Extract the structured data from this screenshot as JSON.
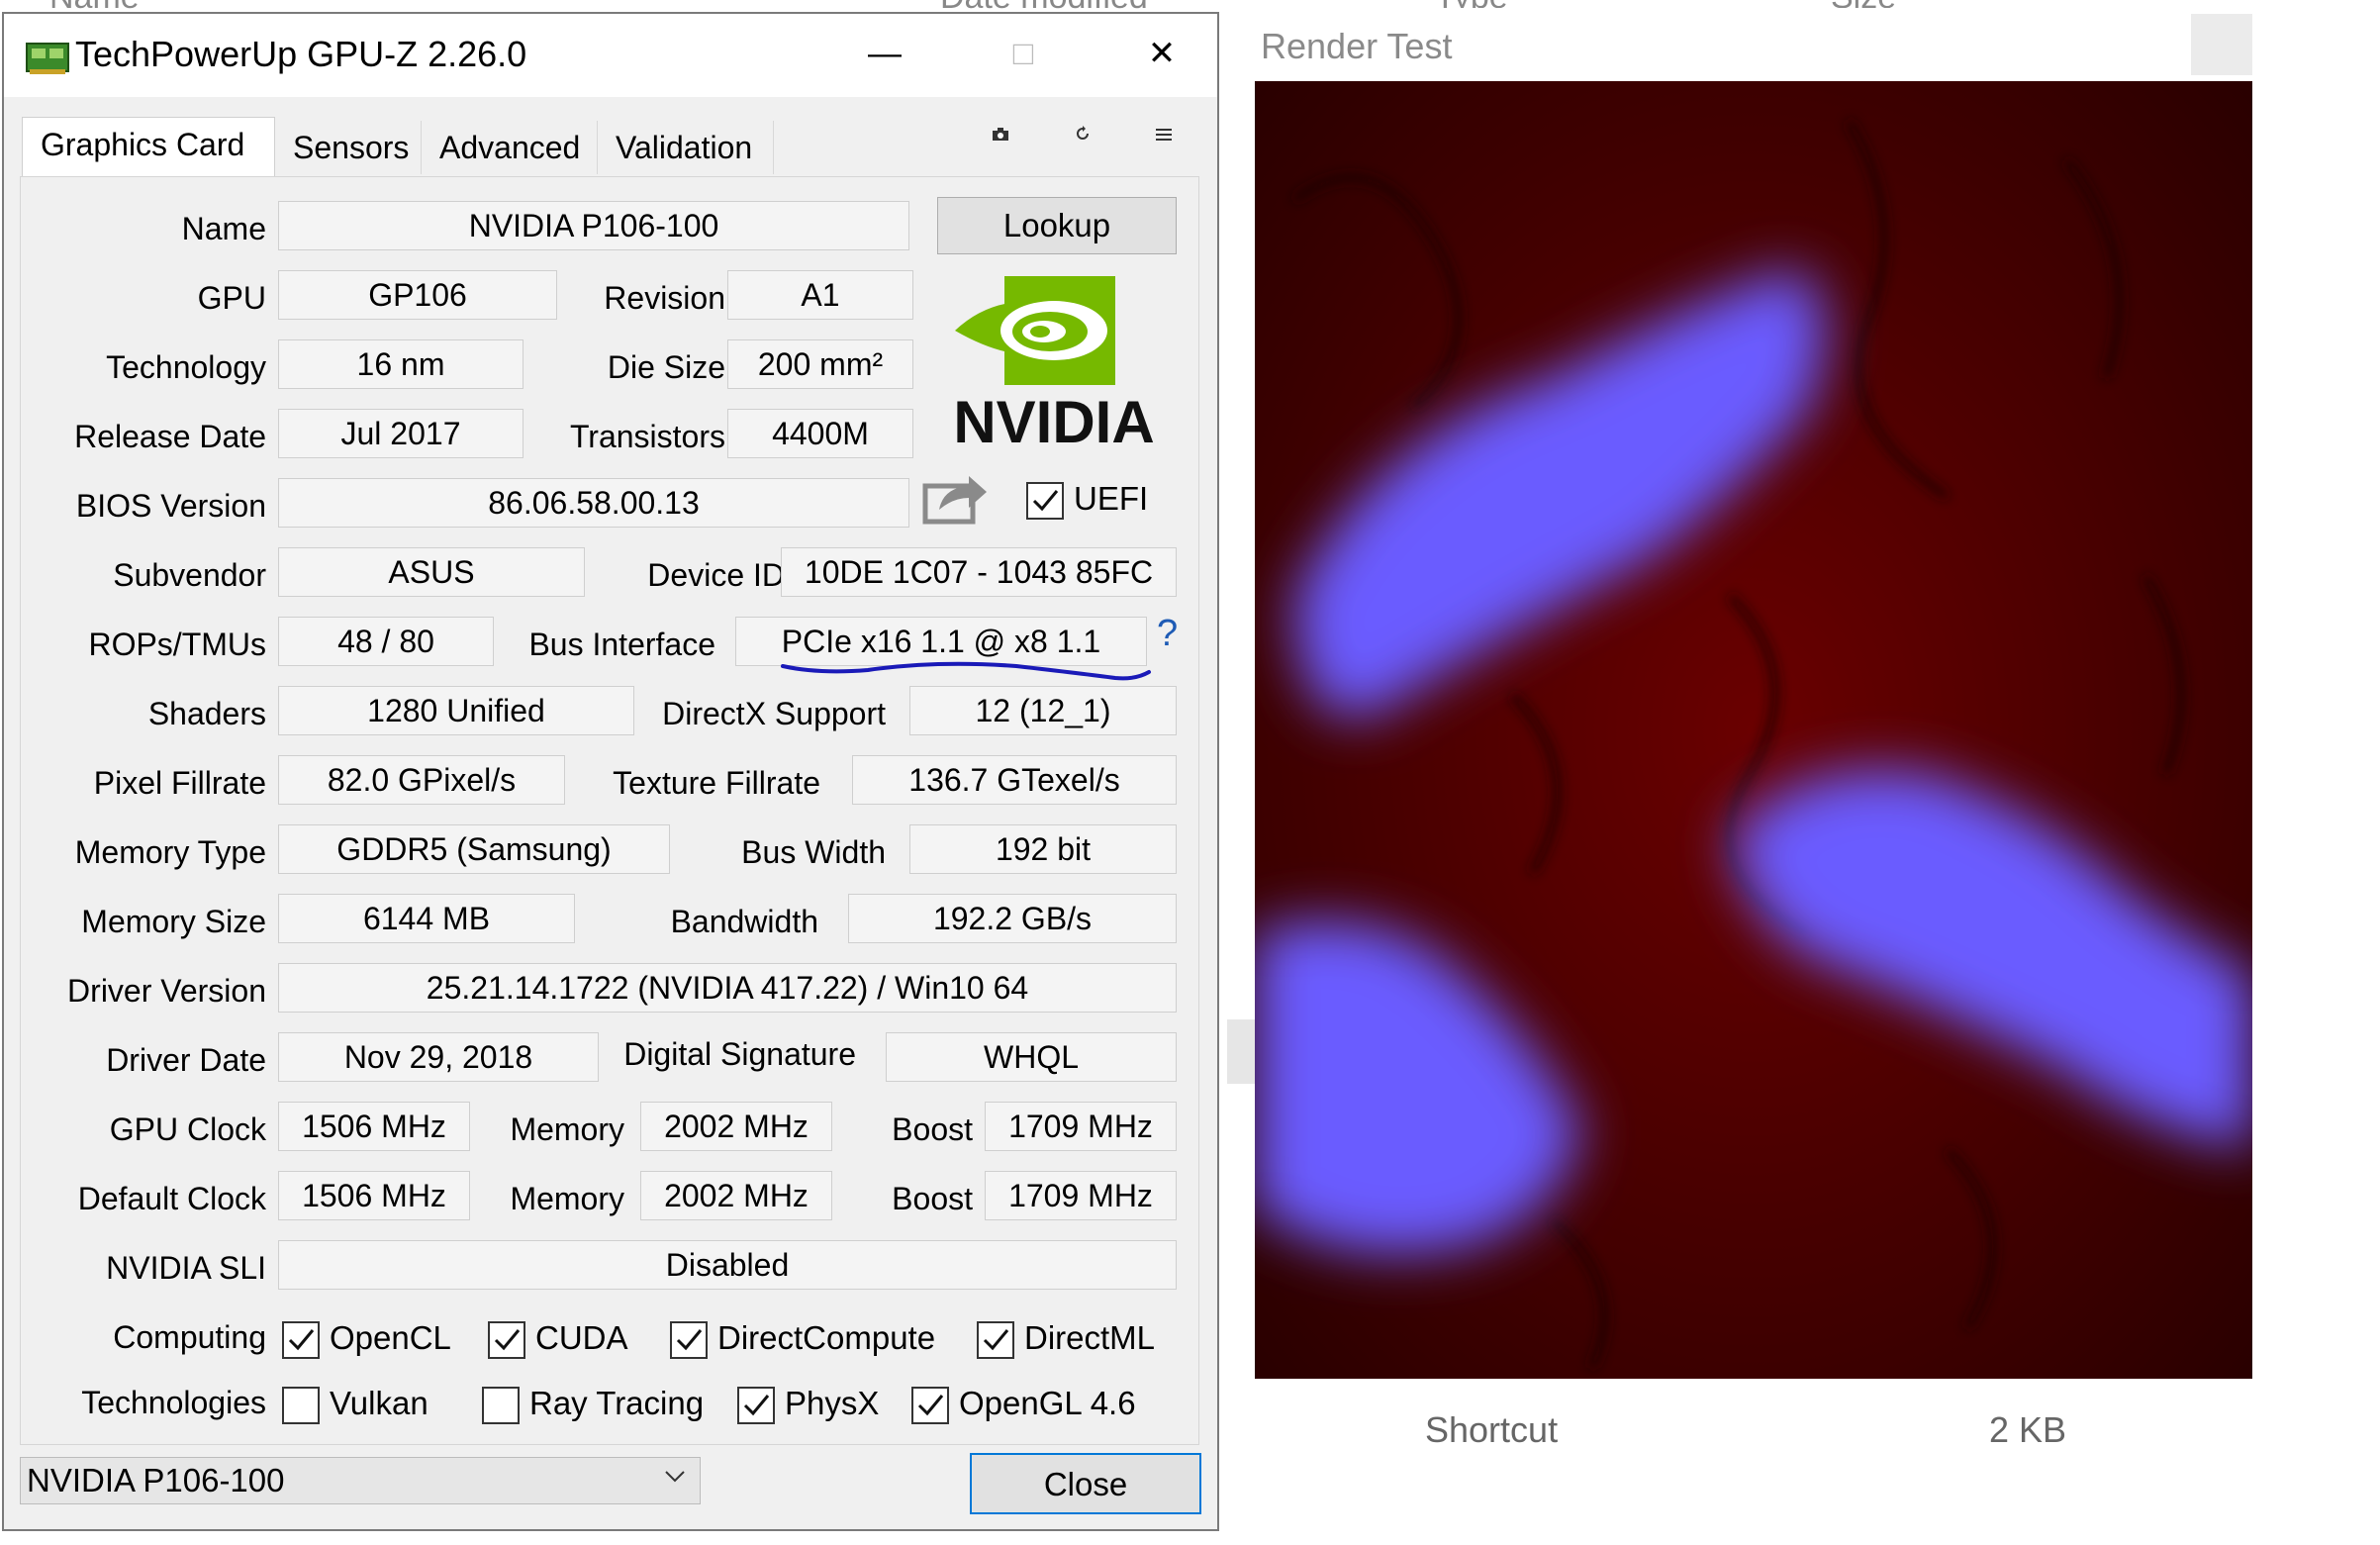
{
  "background_explorer": {
    "col_name": "Name",
    "col_date": "Date modified",
    "col_type": "Type",
    "col_size": "Size",
    "row_type": "Shortcut",
    "row_size": "2 KB"
  },
  "gpuz": {
    "title": "TechPowerUp GPU-Z 2.26.0",
    "window_controls": {
      "minimize": "—",
      "maximize": "□",
      "close": "✕"
    },
    "tabs": [
      {
        "label": "Graphics Card",
        "active": true
      },
      {
        "label": "Sensors",
        "active": false
      },
      {
        "label": "Advanced",
        "active": false
      },
      {
        "label": "Validation",
        "active": false
      }
    ],
    "toolbar_icons": [
      "camera-icon",
      "refresh-icon",
      "menu-icon"
    ],
    "labels": {
      "name": "Name",
      "gpu": "GPU",
      "revision": "Revision",
      "technology": "Technology",
      "die_size": "Die Size",
      "release_date": "Release Date",
      "transistors": "Transistors",
      "bios_version": "BIOS Version",
      "subvendor": "Subvendor",
      "device_id": "Device ID",
      "rops_tmus": "ROPs/TMUs",
      "bus_interface": "Bus Interface",
      "shaders": "Shaders",
      "directx_support": "DirectX Support",
      "pixel_fillrate": "Pixel Fillrate",
      "texture_fillrate": "Texture Fillrate",
      "memory_type": "Memory Type",
      "bus_width": "Bus Width",
      "memory_size": "Memory Size",
      "bandwidth": "Bandwidth",
      "driver_version": "Driver Version",
      "driver_date": "Driver Date",
      "digital_signature": "Digital Signature",
      "gpu_clock": "GPU Clock",
      "memory": "Memory",
      "boost": "Boost",
      "default_clock": "Default Clock",
      "nvidia_sli": "NVIDIA SLI",
      "computing": "Computing",
      "technologies": "Technologies"
    },
    "values": {
      "name": "NVIDIA P106-100",
      "gpu": "GP106",
      "revision": "A1",
      "technology": "16 nm",
      "die_size": "200 mm²",
      "release_date": "Jul 2017",
      "transistors": "4400M",
      "bios_version": "86.06.58.00.13",
      "subvendor": "ASUS",
      "device_id": "10DE 1C07 - 1043 85FC",
      "rops_tmus": "48 / 80",
      "bus_interface": "PCIe x16 1.1 @ x8 1.1",
      "shaders": "1280 Unified",
      "directx_support": "12 (12_1)",
      "pixel_fillrate": "82.0 GPixel/s",
      "texture_fillrate": "136.7 GTexel/s",
      "memory_type": "GDDR5 (Samsung)",
      "bus_width": "192 bit",
      "memory_size": "6144 MB",
      "bandwidth": "192.2 GB/s",
      "driver_version": "25.21.14.1722 (NVIDIA 417.22) / Win10 64",
      "driver_date": "Nov 29, 2018",
      "digital_signature": "WHQL",
      "gpu_clock": "1506 MHz",
      "gpu_memory": "2002 MHz",
      "gpu_boost": "1709 MHz",
      "default_clock": "1506 MHz",
      "default_memory": "2002 MHz",
      "default_boost": "1709 MHz",
      "nvidia_sli": "Disabled"
    },
    "lookup_button": "Lookup",
    "brand_logo_text": "NVIDIA",
    "uefi": {
      "label": "UEFI",
      "checked": true
    },
    "bus_help": "?",
    "computing": [
      {
        "label": "OpenCL",
        "checked": true
      },
      {
        "label": "CUDA",
        "checked": true
      },
      {
        "label": "DirectCompute",
        "checked": true
      },
      {
        "label": "DirectML",
        "checked": true
      }
    ],
    "technologies": [
      {
        "label": "Vulkan",
        "checked": false
      },
      {
        "label": "Ray Tracing",
        "checked": false
      },
      {
        "label": "PhysX",
        "checked": true
      },
      {
        "label": "OpenGL 4.6",
        "checked": true
      }
    ],
    "gpu_select": "NVIDIA P106-100",
    "close_button": "Close"
  },
  "render_test": {
    "title": "Render Test"
  },
  "colors": {
    "nvidia_green": "#76b900",
    "annotation_blue": "#1a1ab8",
    "help_blue": "#1e5bb5",
    "render_red": "#5a0000",
    "render_blue": "#6a5cff"
  }
}
